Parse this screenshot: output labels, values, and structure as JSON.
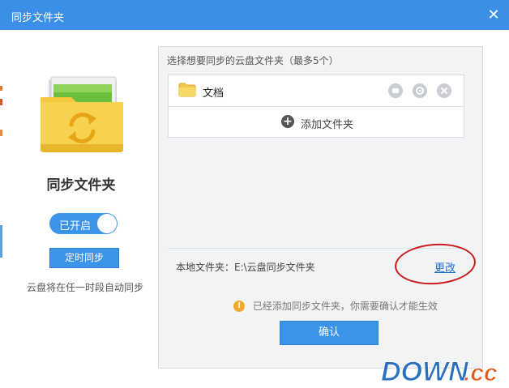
{
  "window": {
    "title": "同步文件夹",
    "close_glyph": "✕"
  },
  "left": {
    "heading": "同步文件夹",
    "toggle_label": "已开启",
    "timer_button": "定时同步",
    "note": "云盘将在任一时段自动同步"
  },
  "panel": {
    "heading": "选择想要同步的云盘文件夹（最多5个）",
    "folders": [
      {
        "name": "文档",
        "icon": "folder-icon"
      }
    ],
    "add_label": "添加文件夹",
    "add_glyph": "+",
    "local_label": "本地文件夹：E:\\云盘同步文件夹",
    "change_link": "更改",
    "info_glyph": "!",
    "info_text": "已经添加同步文件夹，你需要确认才能生效",
    "confirm_button": "确认"
  },
  "watermark": {
    "text": "DOWN.cc"
  },
  "colors": {
    "titlebar": "#3c8fe6",
    "accent": "#3b93ea",
    "link": "#1f6fc9",
    "annotation": "#c91d1d",
    "warning": "#f0a830"
  }
}
